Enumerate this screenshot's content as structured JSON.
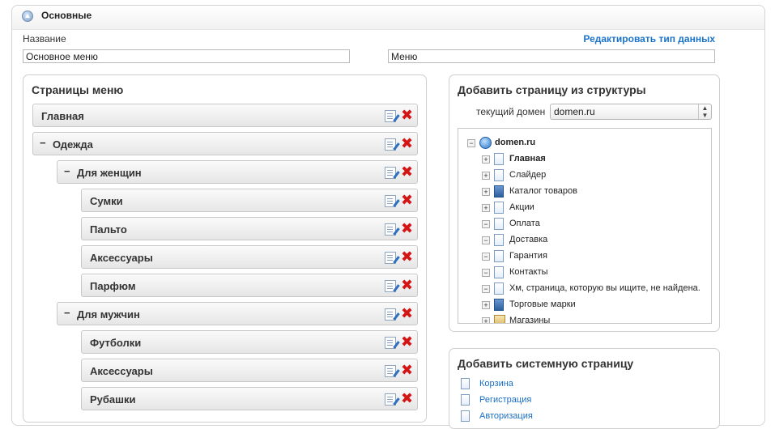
{
  "header": {
    "title": "Основные"
  },
  "form": {
    "name_label": "Название",
    "edit_type_link": "Редактировать тип данных",
    "field1_value": "Основное меню",
    "field2_value": "Меню"
  },
  "menu_panel": {
    "title": "Страницы меню",
    "items": [
      {
        "label": "Главная",
        "expanded_marker": ""
      },
      {
        "label": "Одежда",
        "expanded_marker": "−"
      },
      {
        "label": "Для женщин",
        "expanded_marker": "−"
      },
      {
        "label": "Сумки",
        "expanded_marker": ""
      },
      {
        "label": "Пальто",
        "expanded_marker": ""
      },
      {
        "label": "Аксессуары",
        "expanded_marker": ""
      },
      {
        "label": "Парфюм",
        "expanded_marker": ""
      },
      {
        "label": "Для мужчин",
        "expanded_marker": "−"
      },
      {
        "label": "Футболки",
        "expanded_marker": ""
      },
      {
        "label": "Аксессуары",
        "expanded_marker": ""
      },
      {
        "label": "Рубашки",
        "expanded_marker": ""
      }
    ],
    "delete_glyph": "✖"
  },
  "structure_panel": {
    "title": "Добавить страницу из структуры",
    "domain_label": "текущий домен",
    "domain_value": "domen.ru",
    "select_arrows": "▲▼",
    "tree": {
      "root": {
        "label": "domen.ru",
        "toggle": "−"
      },
      "items": [
        {
          "label": "Главная",
          "toggle": "+",
          "icon": "page-icon",
          "bold": true
        },
        {
          "label": "Слайдер",
          "toggle": "+",
          "icon": "page-icon",
          "bold": false
        },
        {
          "label": "Каталог товаров",
          "toggle": "+",
          "icon": "catalog-icon",
          "bold": false
        },
        {
          "label": "Акции",
          "toggle": "+",
          "icon": "list-page-icon",
          "bold": false
        },
        {
          "label": "Оплата",
          "toggle": "−",
          "icon": "page-icon",
          "bold": false
        },
        {
          "label": "Доставка",
          "toggle": "−",
          "icon": "page-icon",
          "bold": false
        },
        {
          "label": "Гарантия",
          "toggle": "−",
          "icon": "page-icon",
          "bold": false
        },
        {
          "label": "Контакты",
          "toggle": "−",
          "icon": "page-icon",
          "bold": false
        },
        {
          "label": "Хм, страница, которую вы ищите, не найдена.",
          "toggle": "−",
          "icon": "page-icon",
          "bold": false
        },
        {
          "label": "Торговые марки",
          "toggle": "+",
          "icon": "catalog-icon",
          "bold": false
        },
        {
          "label": "Магазины",
          "toggle": "+",
          "icon": "folder-icon",
          "bold": false
        }
      ]
    }
  },
  "system_panel": {
    "title": "Добавить системную страницу",
    "items": [
      "Корзина",
      "Регистрация",
      "Авторизация"
    ]
  }
}
